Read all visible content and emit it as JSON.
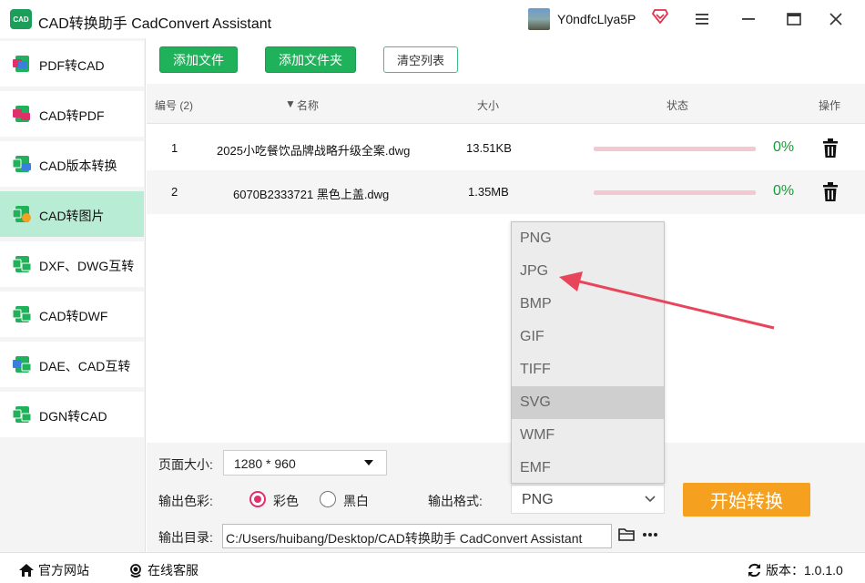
{
  "app": {
    "title": "CAD转换助手 CadConvert Assistant",
    "logo_text": "CAD",
    "user_name": "Y0ndfcLlya5P"
  },
  "sidebar": {
    "items": [
      {
        "label": "PDF转CAD",
        "icon": "pdf-to-cad-icon",
        "active": false
      },
      {
        "label": "CAD转PDF",
        "icon": "cad-to-pdf-icon",
        "active": false
      },
      {
        "label": "CAD版本转换",
        "icon": "cad-version-icon",
        "active": false
      },
      {
        "label": "CAD转图片",
        "icon": "cad-to-image-icon",
        "active": true
      },
      {
        "label": "DXF、DWG互转",
        "icon": "dxf-dwg-icon",
        "active": false
      },
      {
        "label": "CAD转DWF",
        "icon": "cad-to-dwf-icon",
        "active": false
      },
      {
        "label": "DAE、CAD互转",
        "icon": "dae-cad-icon",
        "active": false
      },
      {
        "label": "DGN转CAD",
        "icon": "dgn-to-cad-icon",
        "active": false
      }
    ]
  },
  "toolbar": {
    "add_file": "添加文件",
    "add_folder": "添加文件夹",
    "clear_list": "清空列表"
  },
  "table": {
    "headers": {
      "index": "编号 (2)",
      "name": "名称",
      "size": "大小",
      "status": "状态",
      "action": "操作"
    },
    "rows": [
      {
        "index": "1",
        "name": "2025小吃餐饮品牌战略升级全案.dwg",
        "size": "13.51KB",
        "progress": 0,
        "percent": "0%"
      },
      {
        "index": "2",
        "name": "6070B2333721 黑色上盖.dwg",
        "size": "1.35MB",
        "progress": 0,
        "percent": "0%"
      }
    ]
  },
  "settings": {
    "page_size_label": "页面大小:",
    "page_size_value": "1280 * 960",
    "color_label": "输出色彩:",
    "color_option": "彩色",
    "bw_option": "黑白",
    "color_selected": "彩色",
    "format_label": "输出格式:",
    "format_value": "PNG",
    "format_options": [
      "PNG",
      "JPG",
      "BMP",
      "GIF",
      "TIFF",
      "SVG",
      "WMF",
      "EMF"
    ],
    "format_highlighted": "SVG",
    "output_dir_label": "输出目录:",
    "output_dir_value": "C:/Users/huibang/Desktop/CAD转换助手 CadConvert Assistant",
    "start_button": "开始转换"
  },
  "statusbar": {
    "website": "官方网站",
    "support": "在线客服",
    "version": "版本：1.0.1.0"
  },
  "colors": {
    "accent_green": "#1fb25a",
    "active_sidebar": "#b9ecd5",
    "start_orange": "#f5a01f",
    "progress_track": "#f2c9d2",
    "annotation_arrow": "#e8445a"
  }
}
